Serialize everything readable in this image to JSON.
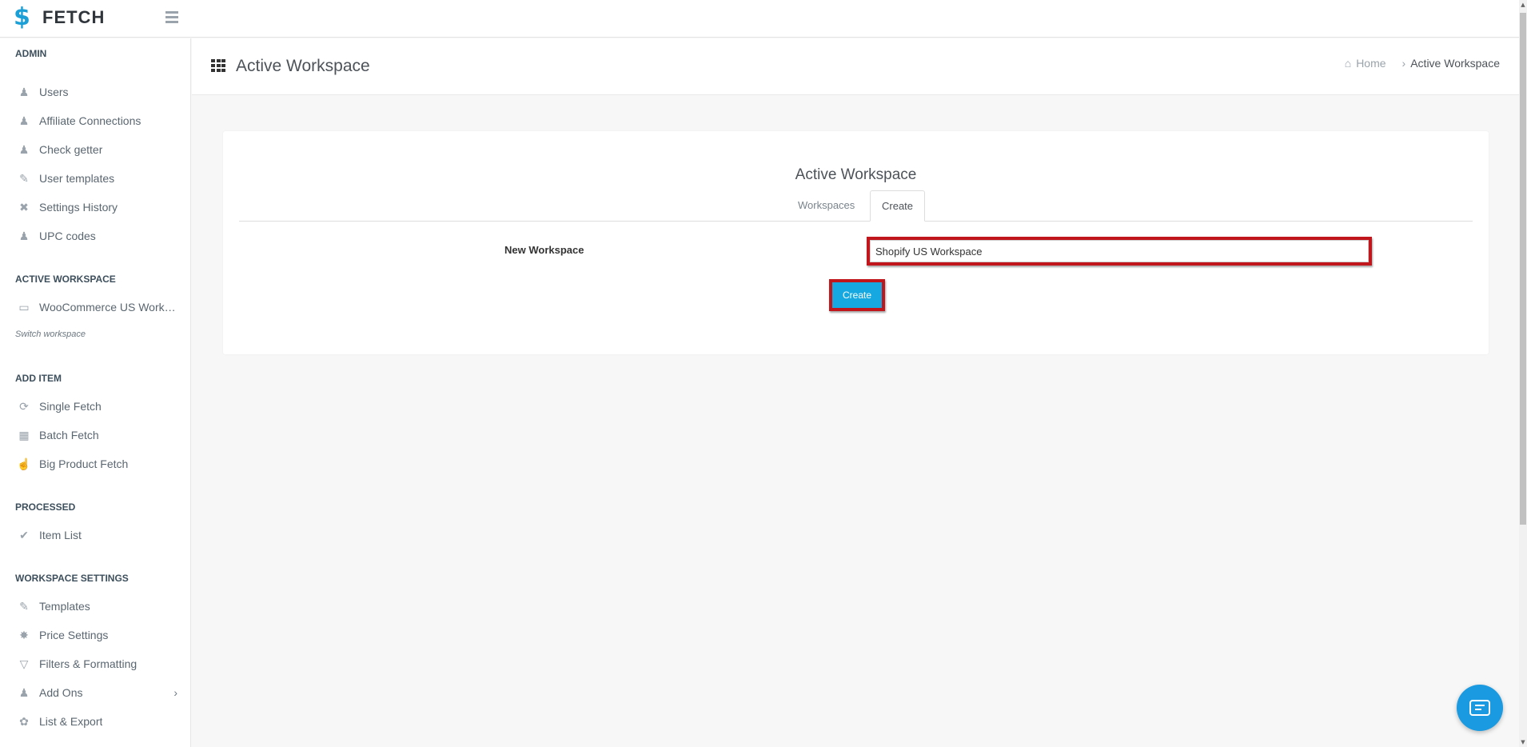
{
  "app": {
    "name": "FETCH"
  },
  "sidebar": {
    "sections": [
      {
        "title": "ADMIN",
        "items": [
          {
            "label": "Users",
            "icon": "users-icon"
          },
          {
            "label": "Affiliate Connections",
            "icon": "users-icon"
          },
          {
            "label": "Check getter",
            "icon": "users-icon"
          },
          {
            "label": "User templates",
            "icon": "pencil-icon"
          },
          {
            "label": "Settings History",
            "icon": "history-icon"
          },
          {
            "label": "UPC codes",
            "icon": "users-icon"
          }
        ]
      },
      {
        "title": "ACTIVE WORKSPACE",
        "items": [
          {
            "label": "WooCommerce US Workspace",
            "icon": "monitor-icon"
          }
        ],
        "link": "Switch workspace"
      },
      {
        "title": "ADD ITEM",
        "items": [
          {
            "label": "Single Fetch",
            "icon": "single-fetch-icon"
          },
          {
            "label": "Batch Fetch",
            "icon": "batch-fetch-icon"
          },
          {
            "label": "Big Product Fetch",
            "icon": "hand-icon"
          }
        ]
      },
      {
        "title": "PROCESSED",
        "items": [
          {
            "label": "Item List",
            "icon": "checklist-icon"
          }
        ]
      },
      {
        "title": "WORKSPACE SETTINGS",
        "items": [
          {
            "label": "Templates",
            "icon": "pencil-icon"
          },
          {
            "label": "Price Settings",
            "icon": "tag-icon"
          },
          {
            "label": "Filters & Formatting",
            "icon": "filter-icon"
          },
          {
            "label": "Add Ons",
            "icon": "user-plus-icon"
          },
          {
            "label": "List & Export",
            "icon": "wrench-icon"
          }
        ]
      }
    ]
  },
  "header": {
    "title": "Active Workspace",
    "breadcrumb": {
      "home": "Home",
      "current": "Active Workspace"
    }
  },
  "card": {
    "title": "Active Workspace",
    "tabs": [
      {
        "label": "Workspaces"
      },
      {
        "label": "Create"
      }
    ],
    "form": {
      "label": "New Workspace",
      "value": "Shopify US Workspace",
      "button": "Create"
    }
  },
  "colors": {
    "accent": "#16a8e0",
    "highlight": "#c0161c",
    "brand": "#1aa0d6"
  }
}
